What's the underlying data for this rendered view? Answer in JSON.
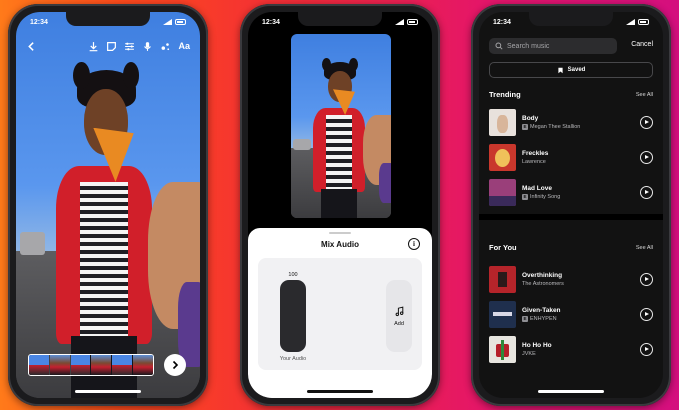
{
  "phones": [
    {
      "status_time": "12:34",
      "toolbar": {
        "back_icon": "chevron-left-icon",
        "tools": [
          "download-icon",
          "sticker-icon",
          "sliders-icon",
          "microphone-icon",
          "effects-icon"
        ],
        "text_tool_label": "Aa"
      },
      "next_icon": "chevron-right-icon"
    },
    {
      "status_time": "12:34",
      "mix_audio": {
        "title": "Mix Audio",
        "info_label": "i",
        "your_audio_volume": "100",
        "your_audio_label": "Your Audio",
        "add_label": "Add"
      }
    },
    {
      "status_time": "12:34",
      "search": {
        "placeholder": "Search music",
        "cancel_label": "Cancel"
      },
      "saved_label": "Saved",
      "sections": [
        {
          "title": "Trending",
          "see_all": "See All",
          "songs": [
            {
              "title": "Body",
              "artist": "Megan Thee Stallion",
              "explicit": true,
              "art_color": "#e8e1dc"
            },
            {
              "title": "Freckles",
              "artist": "Lawrence",
              "explicit": false,
              "art_color": "#c9372c"
            },
            {
              "title": "Mad Love",
              "artist": "Infinity Song",
              "explicit": true,
              "art_color": "#9a3f7a"
            }
          ]
        },
        {
          "title": "For You",
          "see_all": "See All",
          "songs": [
            {
              "title": "Overthinking",
              "artist": "The Astronomers",
              "explicit": false,
              "art_color": "#b5242a"
            },
            {
              "title": "Given-Taken",
              "artist": "ENHYPEN",
              "explicit": true,
              "art_color": "#1f2f4d"
            },
            {
              "title": "Ho Ho Ho",
              "artist": "JVKE",
              "explicit": false,
              "art_color": "#e7e5df"
            }
          ]
        }
      ]
    }
  ],
  "colors": {
    "background_gradient": [
      "#ff7a1a",
      "#e4156a",
      "#d40f7e"
    ]
  }
}
